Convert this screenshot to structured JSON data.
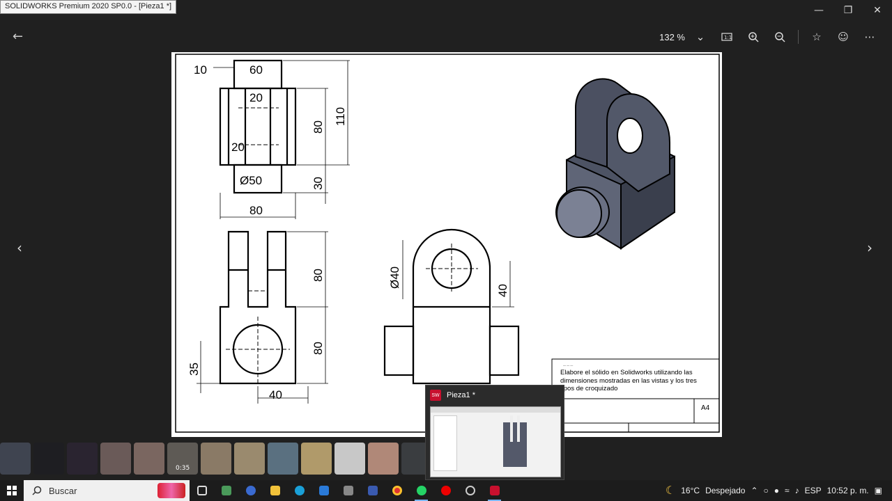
{
  "window": {
    "title": "SOLIDWORKS Premium 2020 SP0.0 - [Pieza1 *]"
  },
  "window_controls": {
    "minimize": "—",
    "restore": "❐",
    "close": "✕"
  },
  "toolbar": {
    "zoom": "132 %"
  },
  "drawing": {
    "dimensions": {
      "top": [
        "10",
        "60",
        "20",
        "20",
        "110",
        "80",
        "Ø50",
        "30",
        "80"
      ],
      "front": [
        "80",
        "80",
        "35",
        "40"
      ],
      "side": [
        "Ø40",
        "40"
      ]
    },
    "titleblock": {
      "instruction": "Elabore el sólido en Solidworks utilizando las dimensiones mostradas en las vistas y los tres tipos de croquizado",
      "size": "A4"
    }
  },
  "thumbnails": {
    "video_duration": "0:35"
  },
  "popup": {
    "title": "Pieza1 *",
    "logo": "SW"
  },
  "taskbar": {
    "search_placeholder": "Buscar",
    "weather_temp": "16°C",
    "weather_text": "Despejado",
    "language": "ESP",
    "time": "10:52 p. m."
  }
}
